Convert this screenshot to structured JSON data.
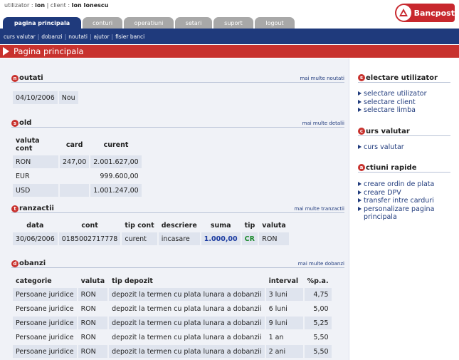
{
  "header": {
    "user_label": "utilizator :",
    "user_value": "ion",
    "client_label": "| client :",
    "client_value": "Ion Ionescu",
    "brand": "Bancpost"
  },
  "tabs": [
    {
      "label": "pagina principala",
      "active": true
    },
    {
      "label": "conturi"
    },
    {
      "label": "operatiuni"
    },
    {
      "label": "setari"
    },
    {
      "label": "suport"
    },
    {
      "label": "logout"
    }
  ],
  "subnav": [
    "curs valutar",
    "dobanzi",
    "noutati",
    "ajutor",
    "fisier banci"
  ],
  "page_title": "Pagina principala",
  "noutati": {
    "title": "outati",
    "letter": "n",
    "more": "mai multe noutati",
    "row": {
      "date": "04/10/2006",
      "status": "Nou"
    }
  },
  "sold": {
    "title": "old",
    "letter": "s",
    "more": "mai multe detalii",
    "headers": [
      "valuta cont",
      "card",
      "curent"
    ],
    "rows": [
      {
        "currency": "RON",
        "card": "247,00",
        "current": "2.001.627,00"
      },
      {
        "currency": "EUR",
        "card": "",
        "current": "999.600,00"
      },
      {
        "currency": "USD",
        "card": "",
        "current": "1.001.247,00"
      }
    ]
  },
  "tranzactii": {
    "title": "ranzactii",
    "letter": "t",
    "more": "mai multe tranzactii",
    "headers": [
      "data",
      "cont",
      "tip cont",
      "descriere",
      "suma",
      "tip",
      "valuta"
    ],
    "row": {
      "date": "30/06/2006",
      "account": "0185002717778",
      "type": "curent",
      "desc": "incasare",
      "amount": "1.000,00",
      "kind": "CR",
      "currency": "RON"
    }
  },
  "dobanzi": {
    "title": "obanzi",
    "letter": "d",
    "more": "mai multe dobanzi",
    "headers": [
      "categorie",
      "valuta",
      "tip depozit",
      "interval",
      "%p.a."
    ],
    "rows": [
      {
        "cat": "Persoane juridice",
        "cur": "RON",
        "dep": "depozit la termen cu plata lunara a dobanzii",
        "int": "3 luni",
        "rate": "4,75"
      },
      {
        "cat": "Persoane juridice",
        "cur": "RON",
        "dep": "depozit la termen cu plata lunara a dobanzii",
        "int": "6 luni",
        "rate": "5,00"
      },
      {
        "cat": "Persoane juridice",
        "cur": "RON",
        "dep": "depozit la termen cu plata lunara a dobanzii",
        "int": "9 luni",
        "rate": "5,25"
      },
      {
        "cat": "Persoane juridice",
        "cur": "RON",
        "dep": "depozit la termen cu plata lunara a dobanzii",
        "int": "1 an",
        "rate": "5,50"
      },
      {
        "cat": "Persoane juridice",
        "cur": "RON",
        "dep": "depozit la termen cu plata lunara a dobanzii",
        "int": "2 ani",
        "rate": "5,50"
      }
    ]
  },
  "sidebar": {
    "selectare": {
      "letter": "s",
      "title": "electare utilizator",
      "items": [
        "selectare utilizator",
        "selectare client",
        "selectare limba"
      ]
    },
    "curs": {
      "letter": "c",
      "title": "urs valutar",
      "items": [
        "curs valutar"
      ]
    },
    "actiuni": {
      "letter": "a",
      "title": "ctiuni rapide",
      "items": [
        "creare ordin de plata",
        "creare DPV",
        "transfer intre carduri",
        "personalizare pagina principala"
      ]
    }
  },
  "colors": {
    "brand_red": "#c8322e",
    "navy": "#1f3a7c",
    "cell": "#dfe4ee"
  }
}
